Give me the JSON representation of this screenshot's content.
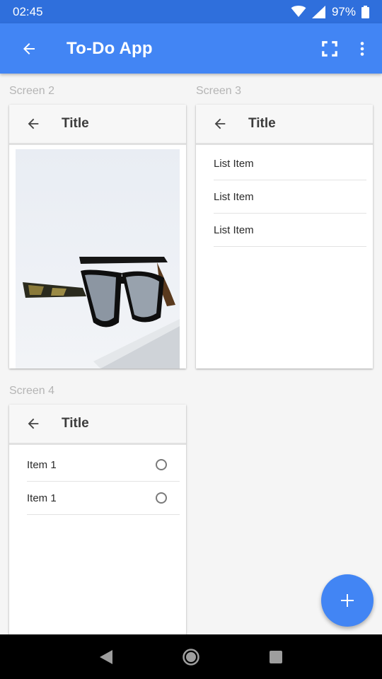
{
  "status_bar": {
    "time": "02:45",
    "battery": "97%"
  },
  "app_bar": {
    "title": "To-Do App",
    "icons": [
      "arrow-back-icon",
      "fullscreen-icon",
      "more-vert-icon"
    ],
    "background": "#4285f4"
  },
  "screens": [
    {
      "label": "Screen 2",
      "title": "Title",
      "content": "image",
      "image": "sunglasses-photo"
    },
    {
      "label": "Screen 3",
      "title": "Title",
      "items": [
        "List Item",
        "List Item",
        "List Item"
      ]
    },
    {
      "label": "Screen 4",
      "title": "Title",
      "items": [
        "Item 1",
        "Item 1"
      ]
    }
  ],
  "fab": {
    "icon": "plus-icon",
    "color": "#4285f4"
  },
  "nav_bar": {
    "icons": [
      "nav-back-icon",
      "nav-home-icon",
      "nav-recents-icon"
    ]
  }
}
